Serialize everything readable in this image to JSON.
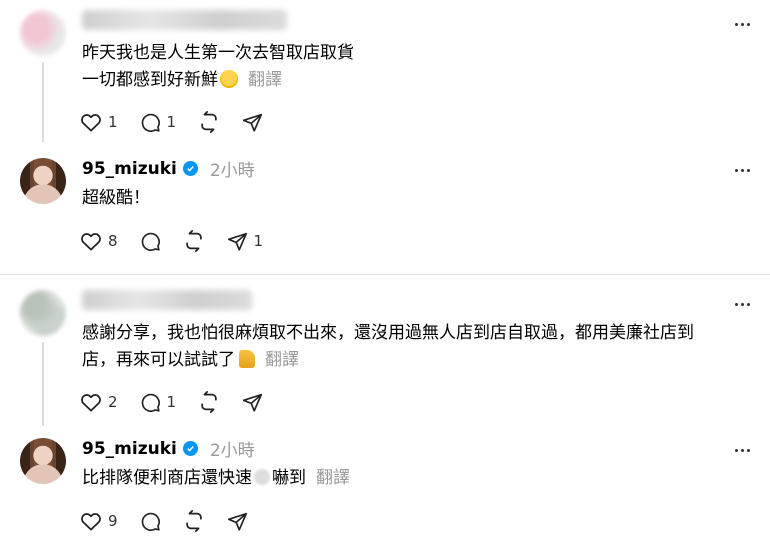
{
  "posts": [
    {
      "username_obscured": "",
      "lines": [
        "昨天我也是人生第一次去智取店取貨",
        "一切都感到好新鮮"
      ],
      "translate": "翻譯",
      "likes": "1",
      "replies": "1"
    },
    {
      "username": "95_mizuki",
      "time": "2小時",
      "text": "超級酷！",
      "likes": "8",
      "shares": "1"
    },
    {
      "lines": [
        "感謝分享，我也怕很麻煩取不出來，還沒用過無人店到店自取過，都用美廉社店到",
        "店，再來可以試試了"
      ],
      "translate": "翻譯",
      "likes": "2",
      "replies": "1"
    },
    {
      "username": "95_mizuki",
      "time": "2小時",
      "text_before": "比排隊便利商店還快速",
      "text_after": "嚇到",
      "translate": "翻譯",
      "likes": "9"
    }
  ],
  "colors": {
    "verified": "#0095f6",
    "muted": "#999999",
    "divider": "#e3e3e3"
  },
  "icons": [
    "heart-icon",
    "comment-icon",
    "repost-icon",
    "share-icon",
    "more-icon",
    "verified-badge-icon"
  ]
}
